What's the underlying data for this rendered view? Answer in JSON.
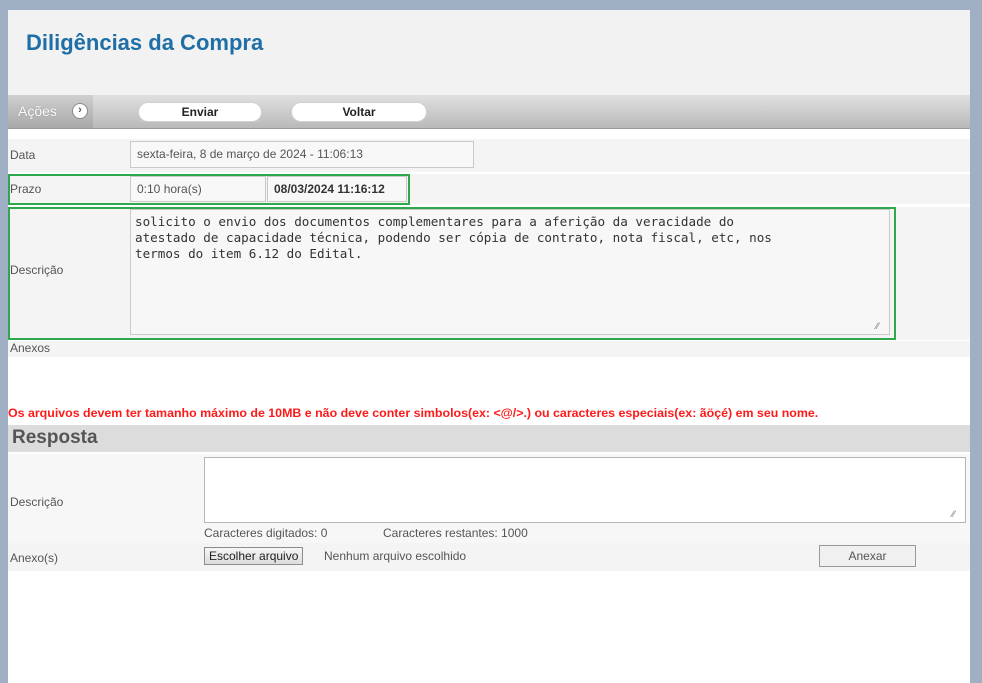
{
  "page": {
    "title": "Diligências da Compra"
  },
  "actions": {
    "label": "Ações",
    "send": "Enviar",
    "back": "Voltar"
  },
  "fields": {
    "data_label": "Data",
    "data_value": "sexta-feira, 8 de março de 2024 - 11:06:13",
    "prazo_label": "Prazo",
    "prazo_hours": "0:10 hora(s)",
    "prazo_deadline": "08/03/2024 11:16:12",
    "descricao_label": "Descrição",
    "descricao_value": "solicito o envio dos documentos complementares para a aferição da veracidade do\natestado de capacidade técnica, podendo ser cópia de contrato, nota fiscal, etc, nos\ntermos do item 6.12 do Edital.",
    "anexos_label": "Anexos"
  },
  "warning": "Os arquivos devem ter tamanho máximo de 10MB e não deve conter simbolos(ex: <@/>.) ou caracteres especiais(ex: ãöçé) em seu nome.",
  "resposta": {
    "header": "Resposta",
    "descricao_label": "Descrição",
    "chars_typed": "Caracteres digitados: 0",
    "chars_remaining": "Caracteres restantes: 1000",
    "anexo_label": "Anexo(s)",
    "choose_file": "Escolher arquivo",
    "no_file": "Nenhum arquivo escolhido",
    "attach": "Anexar"
  }
}
